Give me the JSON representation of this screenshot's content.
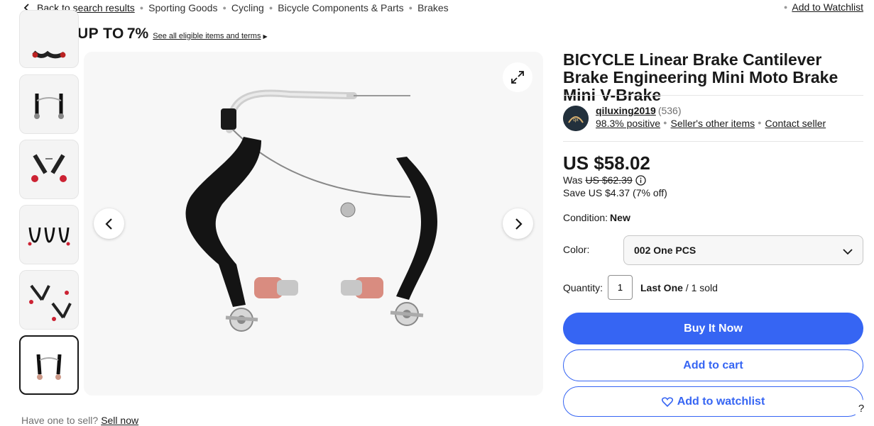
{
  "breadcrumb": {
    "back_label": "Back to search results",
    "items": [
      "Sporting Goods",
      "Cycling",
      "Bicycle Components & Parts",
      "Brakes"
    ]
  },
  "watchlist_top": "Add to Watchlist",
  "promo": {
    "save_label": "SAVE UP TO",
    "save_pct": "7%",
    "see_all": "See all eligible items and terms"
  },
  "product": {
    "title": "BICYCLE Linear Brake Cantilever Brake Engineering Mini Moto Brake Mini V-Brake",
    "seller_name": "qiluxing2019",
    "seller_count": "(536)",
    "positive": "98.3% positive",
    "other_items": "Seller's other items",
    "contact": "Contact seller",
    "price": "US $58.02",
    "was_label": "Was",
    "was_price": "US $62.39",
    "save_line": "Save US $4.37 (7% off)",
    "condition_label": "Condition:",
    "condition_value": "New",
    "color_label": "Color:",
    "color_value": "002 One PCS",
    "quantity_label": "Quantity:",
    "quantity_value": "1",
    "stock_last": "Last One",
    "stock_sold": "/ 1 sold"
  },
  "actions": {
    "buy": "Buy It Now",
    "cart": "Add to cart",
    "watch": "Add to watchlist"
  },
  "sell": {
    "prompt": "Have one to sell?",
    "link": "Sell now"
  },
  "colors": {
    "primary": "#3665f3",
    "text": "#191919",
    "muted": "#707070",
    "promo_red": "#e0103a"
  }
}
